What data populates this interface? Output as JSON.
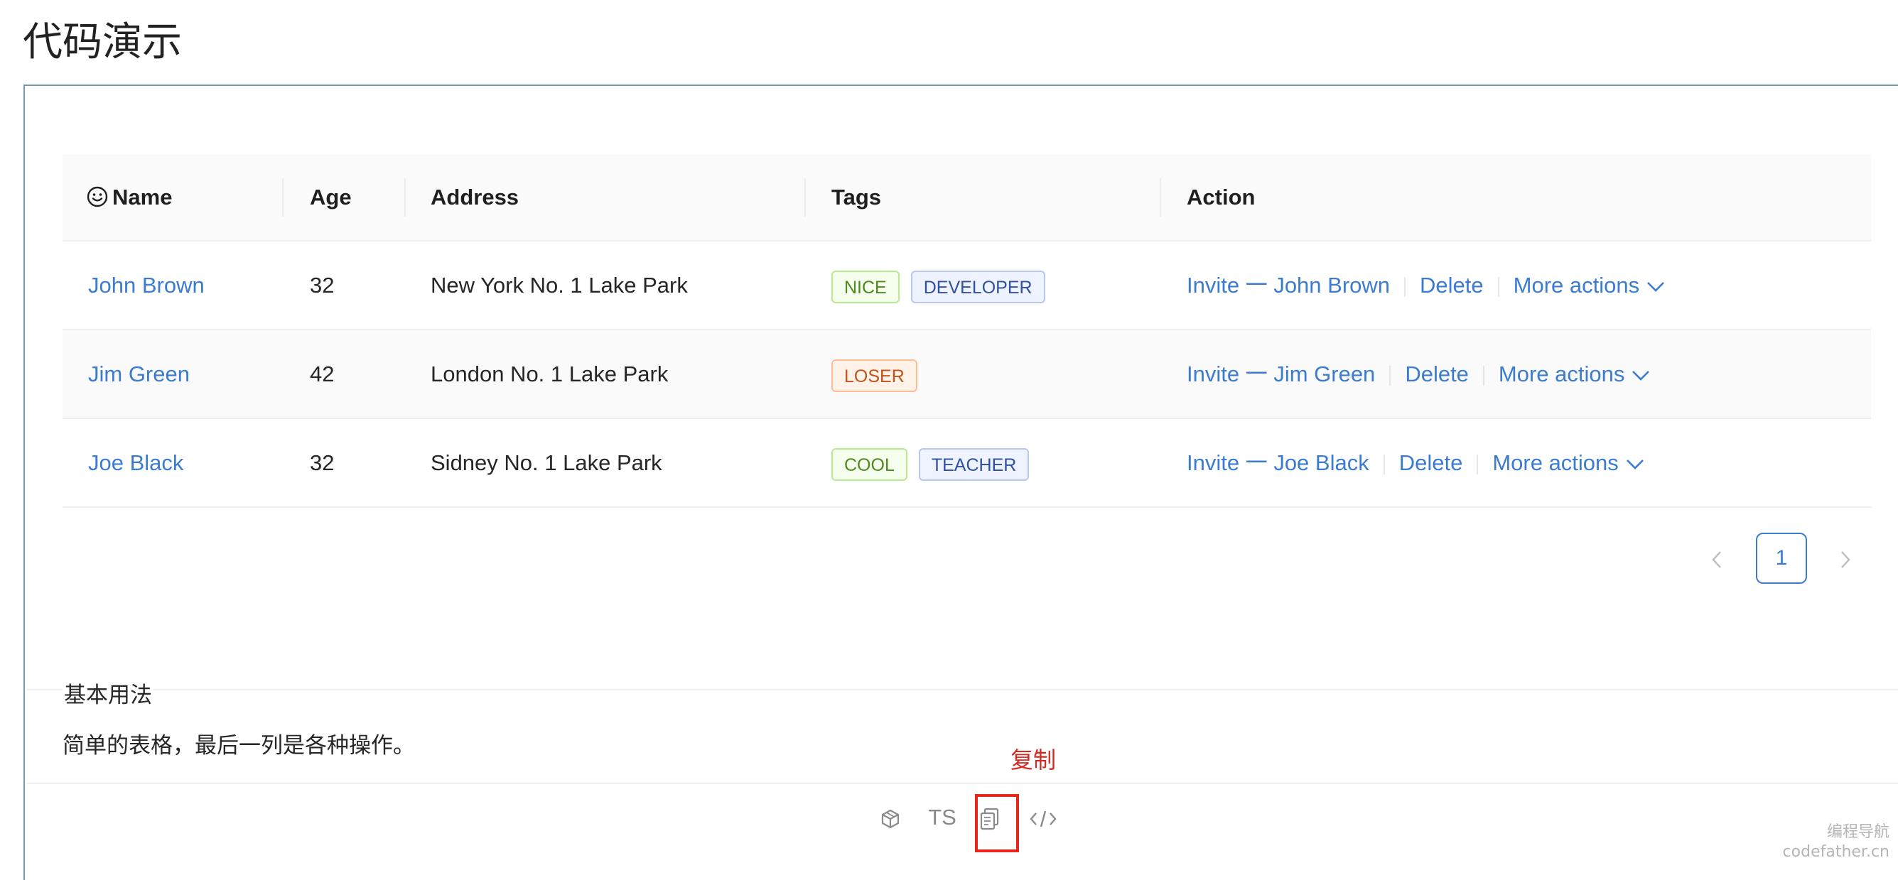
{
  "page": {
    "title": "代码演示"
  },
  "table": {
    "columns": [
      "Name",
      "Age",
      "Address",
      "Tags",
      "Action"
    ],
    "rows": [
      {
        "name": "John Brown",
        "age": "32",
        "address": "New York No. 1 Lake Park",
        "tags": [
          "NICE",
          "DEVELOPER"
        ],
        "invite": "Invite 一 John Brown",
        "delete": "Delete",
        "more": "More actions"
      },
      {
        "name": "Jim Green",
        "age": "42",
        "address": "London No. 1 Lake Park",
        "tags": [
          "LOSER"
        ],
        "invite": "Invite 一 Jim Green",
        "delete": "Delete",
        "more": "More actions"
      },
      {
        "name": "Joe Black",
        "age": "32",
        "address": "Sidney No. 1 Lake Park",
        "tags": [
          "COOL",
          "TEACHER"
        ],
        "invite": "Invite 一 Joe Black",
        "delete": "Delete",
        "more": "More actions"
      }
    ]
  },
  "pagination": {
    "current": "1"
  },
  "section": {
    "title": "基本用法",
    "description": "简单的表格，最后一列是各种操作。"
  },
  "annotation": {
    "label": "复制"
  },
  "toolbar": {
    "ts_label": "TS"
  },
  "watermark": {
    "line1": "编程导航",
    "line2": "codefather.cn"
  },
  "colors": {
    "link": "#3b7bd0",
    "annotation": "#e8261c"
  }
}
